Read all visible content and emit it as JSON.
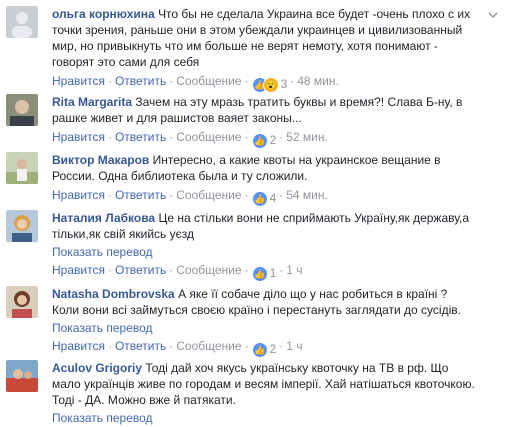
{
  "comments": [
    {
      "author": "ольга корнюхина",
      "text": "Что бы не сделала Украина все будет -очень плохо с их точки зрения, раньше они в этом убеждали украинцев и цивилизованный мир, но привыкнуть что им больше не верят немоту, хотя понимают - говорят это сами для себя",
      "like_label": "Нравится",
      "reply_label": "Ответить",
      "message_label": "Сообщение",
      "reaction_count": "3",
      "time": "48 мин.",
      "translate_label": ""
    },
    {
      "author": "Rita Margarita",
      "text": "Зачем на эту мразь тратить буквы и время?! Слава Б-ну, в рашке живет и для рашистов ваяет законы...",
      "like_label": "Нравится",
      "reply_label": "Ответить",
      "message_label": "Сообщение",
      "reaction_count": "2",
      "time": "52 мин.",
      "translate_label": ""
    },
    {
      "author": "Виктор Макаров",
      "text": "Интересно, а какие квоты на украинское вещание в России. Одна библиотека была и ту сложили.",
      "like_label": "Нравится",
      "reply_label": "Ответить",
      "message_label": "Сообщение",
      "reaction_count": "4",
      "time": "54 мин.",
      "translate_label": ""
    },
    {
      "author": "Наталия Лабкова",
      "text": "Це на стільки вони не сприймають Україну,як державу,а тільки,як свій якийсь уєзд",
      "like_label": "Нравится",
      "reply_label": "Ответить",
      "message_label": "Сообщение",
      "reaction_count": "1",
      "time": "1 ч",
      "translate_label": "Показать перевод"
    },
    {
      "author": "Natasha Dombrovska",
      "text": "А яке її собаче діло що у нас робиться в країні ? Коли вони всі займуться своєю країно і перестануть заглядати до сусідів.",
      "like_label": "Нравится",
      "reply_label": "Ответить",
      "message_label": "Сообщение",
      "reaction_count": "2",
      "time": "1 ч",
      "translate_label": "Показать перевод"
    },
    {
      "author": "Aculov Grigoriy",
      "text": "Тоді дай хоч якусь українську квоточку на ТВ в рф. Що мало українців живе по городам и весям імперії. Хай натішаться квоточкою. Тоді - ДА. Можно вже й патякати.",
      "like_label": "",
      "reply_label": "",
      "message_label": "",
      "reaction_count": "",
      "time": "",
      "translate_label": "Показать перевод"
    }
  ],
  "colors": {
    "author_link": "#365899",
    "action_link": "#4267b2",
    "muted": "#90949c",
    "like_blue": "#5890ff",
    "wow_yellow": "#f7b125"
  },
  "icons": {
    "like": "thumbs-up-icon",
    "wow": "wow-emoji-icon",
    "options": "chevron-down-icon"
  }
}
